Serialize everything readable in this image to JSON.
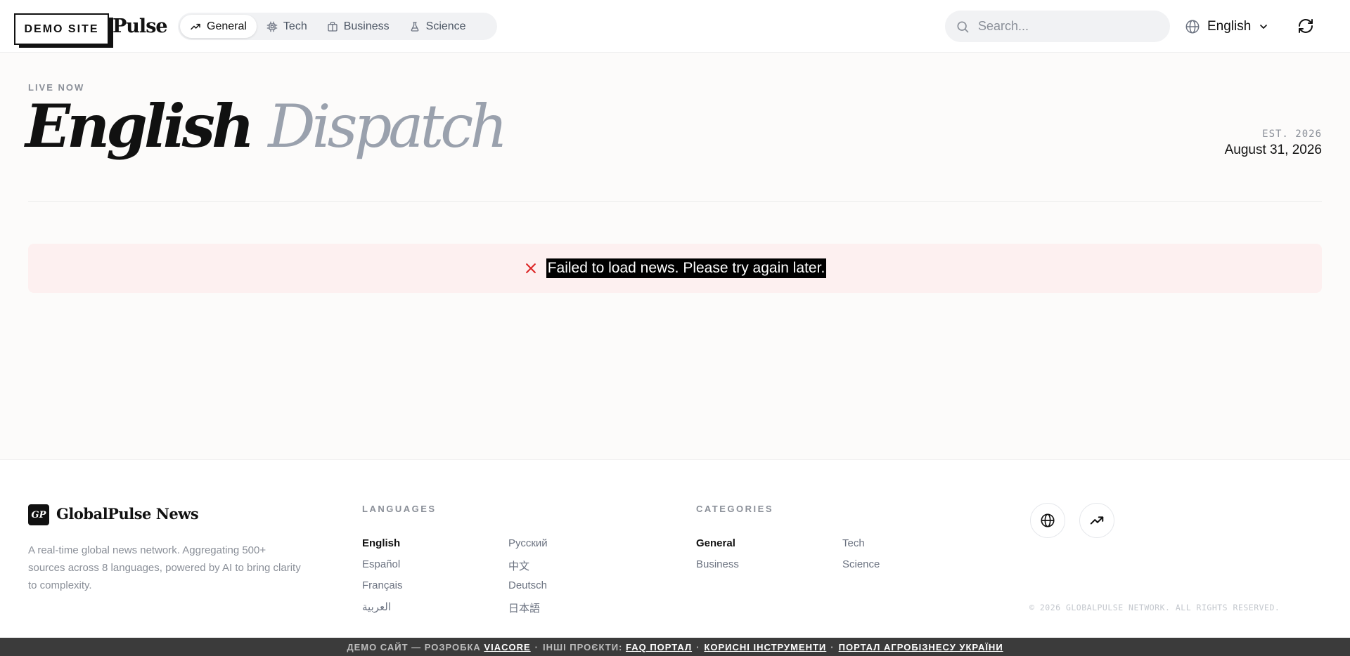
{
  "header": {
    "logo_text": "Pulse",
    "demo_badge": "DEMO SITE",
    "nav": [
      {
        "label": "General",
        "icon": "trending-up-icon"
      },
      {
        "label": "Tech",
        "icon": "cpu-icon"
      },
      {
        "label": "Business",
        "icon": "briefcase-icon"
      },
      {
        "label": "Science",
        "icon": "flask-icon"
      }
    ],
    "search_placeholder": "Search...",
    "language": "English"
  },
  "hero": {
    "live_label": "LIVE NOW",
    "title_word1": "English",
    "title_word2": "Dispatch",
    "est": "EST. 2026",
    "date": "August 31, 2026"
  },
  "error": {
    "message": "Failed to load news. Please try again later."
  },
  "footer": {
    "logo_mark": "GP",
    "brand": "GlobalPulse News",
    "description": "A real-time global news network. Aggregating 500+ sources across 8 languages, powered by AI to bring clarity to complexity.",
    "languages_heading": "LANGUAGES",
    "languages": [
      "English",
      "Русский",
      "Español",
      "中文",
      "Français",
      "Deutsch",
      "العربية",
      "日本語"
    ],
    "categories_heading": "CATEGORIES",
    "categories": [
      "General",
      "Tech",
      "Business",
      "Science"
    ],
    "copyright": "© 2026 GLOBALPULSE NETWORK. ALL RIGHTS RESERVED."
  },
  "bottom_bar": {
    "prefix": "ДЕМО САЙТ — РОЗРОБКА",
    "dev_link": "VIACORE",
    "other": "ІНШІ ПРОЄКТИ:",
    "links": [
      "FAQ ПОРТАЛ",
      "КОРИСНІ ІНСТРУМЕНТИ",
      "ПОРТАЛ АГРОБІЗНЕСУ УКРАЇНИ"
    ]
  },
  "colors": {
    "accent": "#111111",
    "error_bg": "#fdf0f0",
    "error_icon": "#dc2626",
    "muted": "#8a8f98"
  }
}
